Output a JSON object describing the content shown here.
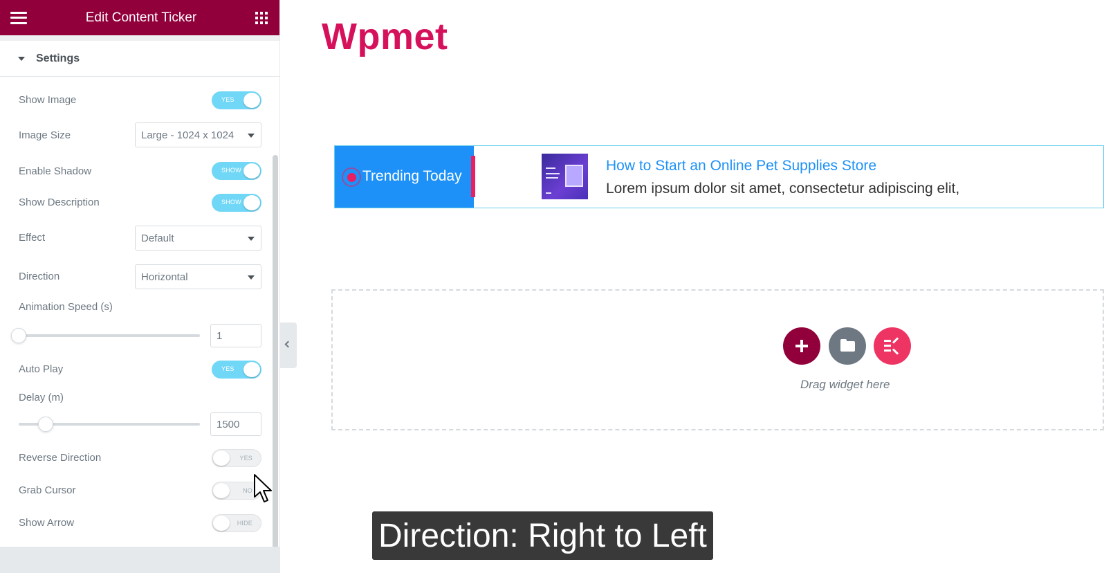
{
  "panel": {
    "title": "Edit Content Ticker",
    "section_title": "Settings",
    "controls": {
      "show_image": {
        "label": "Show Image",
        "toggle_text": "YES",
        "state": "on"
      },
      "image_size": {
        "label": "Image Size",
        "value": "Large - 1024 x 1024"
      },
      "enable_shadow": {
        "label": "Enable Shadow",
        "toggle_text": "SHOW",
        "state": "on"
      },
      "show_description": {
        "label": "Show Description",
        "toggle_text": "SHOW",
        "state": "on"
      },
      "effect": {
        "label": "Effect",
        "value": "Default"
      },
      "direction": {
        "label": "Direction",
        "value": "Horizontal"
      },
      "animation_speed": {
        "label": "Animation Speed (s)",
        "value": "1",
        "slider_fraction": 0.0
      },
      "auto_play": {
        "label": "Auto Play",
        "toggle_text": "YES",
        "state": "on"
      },
      "delay": {
        "label": "Delay (m)",
        "value": "1500",
        "slider_fraction": 0.15
      },
      "reverse_direction": {
        "label": "Reverse Direction",
        "toggle_text": "YES",
        "state": "off"
      },
      "grab_cursor": {
        "label": "Grab Cursor",
        "toggle_text": "NO",
        "state": "off"
      },
      "show_arrow": {
        "label": "Show Arrow",
        "toggle_text": "HIDE",
        "state": "off"
      }
    }
  },
  "canvas": {
    "logo": "Wpmet",
    "ticker": {
      "heading": "Trending Today",
      "post_title": "How to Start an Online Pet Supplies Store",
      "post_description": "Lorem ipsum dolor sit amet, consectetur adipiscing elit,"
    },
    "dropzone_text": "Drag widget here"
  },
  "caption": "Direction: Right to Left",
  "colors": {
    "brand": "#92003b",
    "logo": "#d6115c",
    "toggle_on": "#71d7f7",
    "ticker_head": "#1d91f7",
    "accent_pink": "#e91e63"
  }
}
